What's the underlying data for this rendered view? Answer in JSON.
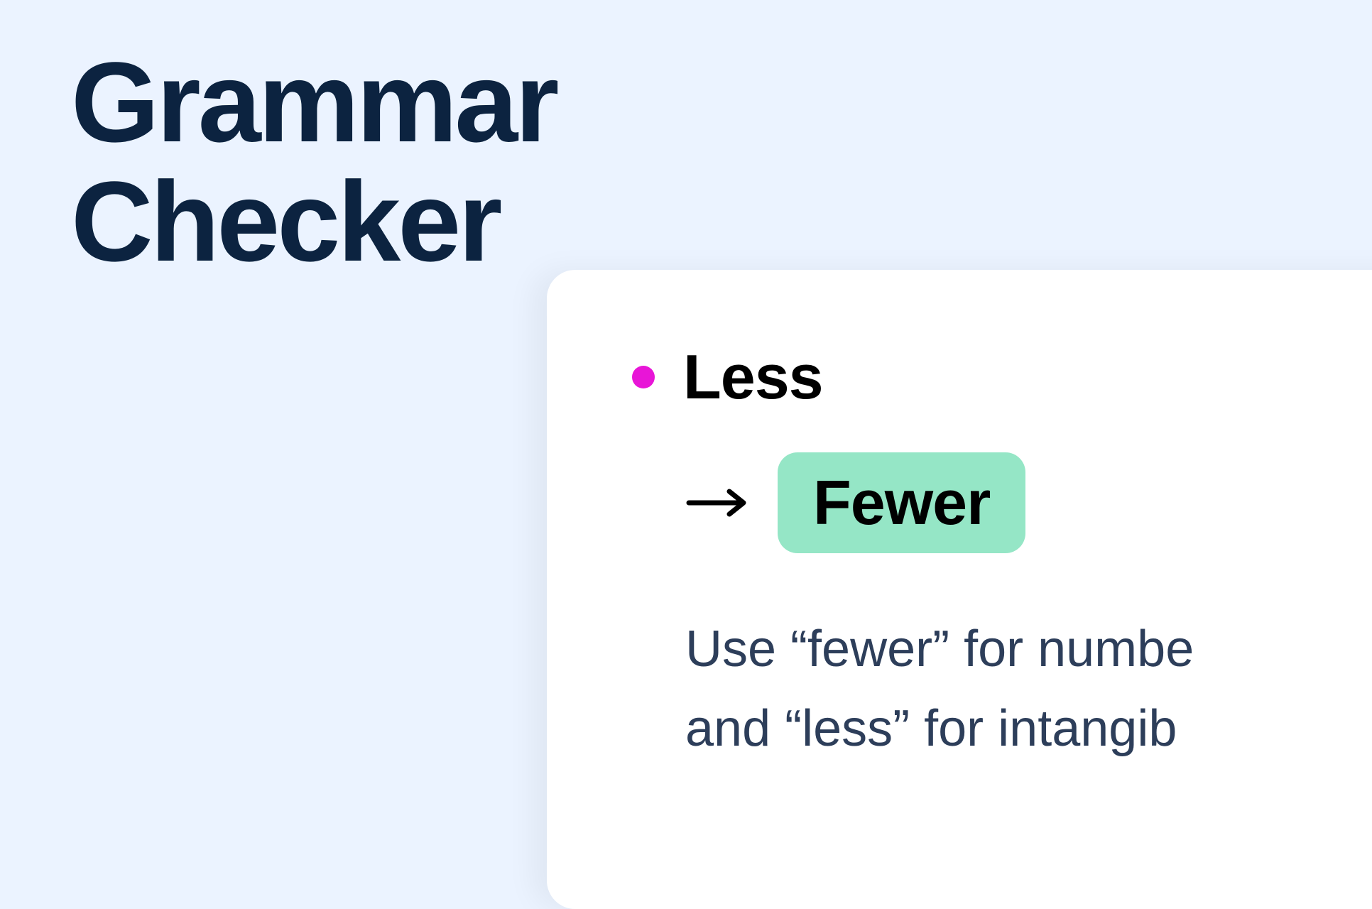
{
  "page": {
    "title_line1": "Grammar",
    "title_line2": "Checker"
  },
  "suggestion": {
    "indicator_color": "#e815d7",
    "incorrect_word": "Less",
    "correct_word": "Fewer",
    "explanation_line1": "Use “fewer” for numbe",
    "explanation_line2": "and “less” for intangib"
  },
  "colors": {
    "background": "#ebf3ff",
    "title_text": "#0c2340",
    "card_background": "#ffffff",
    "pill_background": "#95e6c6",
    "explanation_text": "#2d3e5a"
  }
}
